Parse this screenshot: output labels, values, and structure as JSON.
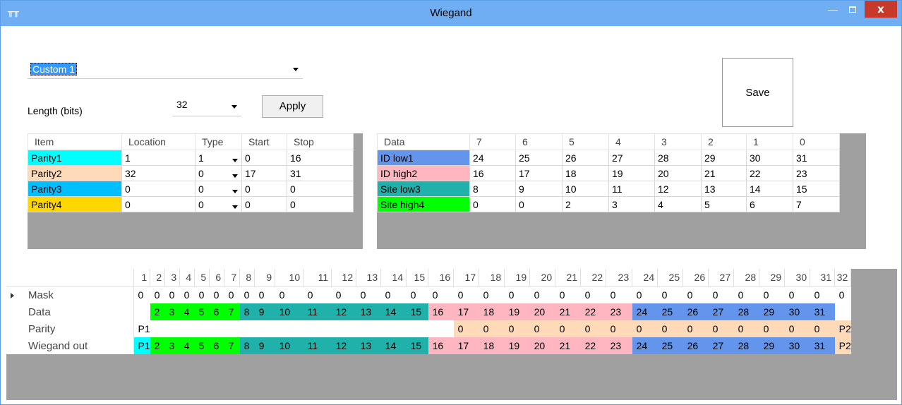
{
  "window": {
    "title": "Wiegand",
    "app_icon": "wiegand-app-icon",
    "minimize": "—",
    "close": "x"
  },
  "preset": {
    "selected": "Custom 1"
  },
  "length": {
    "label": "Length (bits)",
    "selected": "32"
  },
  "apply_label": "Apply",
  "save_label": "Save",
  "parity_grid": {
    "headers": [
      "Item",
      "Location",
      "Type",
      "Start",
      "Stop"
    ],
    "rows": [
      {
        "item": "Parity1",
        "color": "#00ffff",
        "location": "1",
        "type": "1",
        "start": "0",
        "stop": "16"
      },
      {
        "item": "Parity2",
        "color": "#ffdab9",
        "location": "32",
        "type": "0",
        "start": "17",
        "stop": "31"
      },
      {
        "item": "Parity3",
        "color": "#00bfff",
        "location": "0",
        "type": "0",
        "start": "0",
        "stop": "0"
      },
      {
        "item": "Parity4",
        "color": "#ffd700",
        "location": "0",
        "type": "0",
        "start": "0",
        "stop": "0"
      }
    ]
  },
  "data_grid": {
    "headers": [
      "Data",
      "7",
      "6",
      "5",
      "4",
      "3",
      "2",
      "1",
      "0"
    ],
    "rows": [
      {
        "label": "ID low1",
        "color": "#6495ed",
        "values": [
          "24",
          "25",
          "26",
          "27",
          "28",
          "29",
          "30",
          "31"
        ]
      },
      {
        "label": "ID high2",
        "color": "#ffb6c1",
        "values": [
          "16",
          "17",
          "18",
          "19",
          "20",
          "21",
          "22",
          "23"
        ]
      },
      {
        "label": "Site low3",
        "color": "#20b2aa",
        "values": [
          "8",
          "9",
          "10",
          "11",
          "12",
          "13",
          "14",
          "15"
        ]
      },
      {
        "label": "Site high4",
        "color": "#00ff00",
        "values": [
          "0",
          "0",
          "2",
          "3",
          "4",
          "5",
          "6",
          "7"
        ]
      }
    ]
  },
  "bit_grid": {
    "columns": [
      "1",
      "2",
      "3",
      "4",
      "5",
      "6",
      "7",
      "8",
      "9",
      "10",
      "11",
      "12",
      "13",
      "14",
      "15",
      "16",
      "17",
      "18",
      "19",
      "20",
      "21",
      "22",
      "23",
      "24",
      "25",
      "26",
      "27",
      "28",
      "29",
      "30",
      "31",
      "32"
    ],
    "rows": [
      {
        "label": "Mask",
        "current": true,
        "cells": [
          "0",
          "0",
          "0",
          "0",
          "0",
          "0",
          "0",
          "0",
          "0",
          "0",
          "0",
          "0",
          "0",
          "0",
          "0",
          "0",
          "0",
          "0",
          "0",
          "0",
          "0",
          "0",
          "0",
          "0",
          "0",
          "0",
          "0",
          "0",
          "0",
          "0",
          "0",
          "0"
        ],
        "colors": [
          "",
          "",
          "",
          "",
          "",
          "",
          "",
          "",
          "",
          "",
          "",
          "",
          "",
          "",
          "",
          "",
          "",
          "",
          "",
          "",
          "",
          "",
          "",
          "",
          "",
          "",
          "",
          "",
          "",
          "",
          "",
          ""
        ]
      },
      {
        "label": "Data",
        "current": false,
        "cells": [
          "",
          "2",
          "3",
          "4",
          "5",
          "6",
          "7",
          "8",
          "9",
          "10",
          "11",
          "12",
          "13",
          "14",
          "15",
          "16",
          "17",
          "18",
          "19",
          "20",
          "21",
          "22",
          "23",
          "24",
          "25",
          "26",
          "27",
          "28",
          "29",
          "30",
          "31",
          ""
        ],
        "colors": [
          "",
          "#00ff00",
          "#00ff00",
          "#00ff00",
          "#00ff00",
          "#00ff00",
          "#00ff00",
          "#20b2aa",
          "#20b2aa",
          "#20b2aa",
          "#20b2aa",
          "#20b2aa",
          "#20b2aa",
          "#20b2aa",
          "#20b2aa",
          "#ffb6c1",
          "#ffb6c1",
          "#ffb6c1",
          "#ffb6c1",
          "#ffb6c1",
          "#ffb6c1",
          "#ffb6c1",
          "#ffb6c1",
          "#6495ed",
          "#6495ed",
          "#6495ed",
          "#6495ed",
          "#6495ed",
          "#6495ed",
          "#6495ed",
          "#6495ed",
          ""
        ]
      },
      {
        "label": "Parity",
        "current": false,
        "cells": [
          "P1",
          "",
          "",
          "",
          "",
          "",
          "",
          "",
          "",
          "",
          "",
          "",
          "",
          "",
          "",
          "",
          "0",
          "0",
          "0",
          "0",
          "0",
          "0",
          "0",
          "0",
          "0",
          "0",
          "0",
          "0",
          "0",
          "0",
          "0",
          "P2"
        ],
        "colors": [
          "",
          "",
          "",
          "",
          "",
          "",
          "",
          "",
          "",
          "",
          "",
          "",
          "",
          "",
          "",
          "",
          "#ffdab9",
          "#ffdab9",
          "#ffdab9",
          "#ffdab9",
          "#ffdab9",
          "#ffdab9",
          "#ffdab9",
          "#ffdab9",
          "#ffdab9",
          "#ffdab9",
          "#ffdab9",
          "#ffdab9",
          "#ffdab9",
          "#ffdab9",
          "#ffdab9",
          "#ffdab9"
        ]
      },
      {
        "label": "Wiegand out",
        "current": false,
        "cells": [
          "P1",
          "2",
          "3",
          "4",
          "5",
          "6",
          "7",
          "8",
          "9",
          "10",
          "11",
          "12",
          "13",
          "14",
          "15",
          "16",
          "17",
          "18",
          "19",
          "20",
          "21",
          "22",
          "23",
          "24",
          "25",
          "26",
          "27",
          "28",
          "29",
          "30",
          "31",
          "P2"
        ],
        "colors": [
          "#00ffff",
          "#00ff00",
          "#00ff00",
          "#00ff00",
          "#00ff00",
          "#00ff00",
          "#00ff00",
          "#20b2aa",
          "#20b2aa",
          "#20b2aa",
          "#20b2aa",
          "#20b2aa",
          "#20b2aa",
          "#20b2aa",
          "#20b2aa",
          "#ffb6c1",
          "#ffb6c1",
          "#ffb6c1",
          "#ffb6c1",
          "#ffb6c1",
          "#ffb6c1",
          "#ffb6c1",
          "#ffb6c1",
          "#6495ed",
          "#6495ed",
          "#6495ed",
          "#6495ed",
          "#6495ed",
          "#6495ed",
          "#6495ed",
          "#6495ed",
          "#ffdab9"
        ]
      }
    ]
  }
}
